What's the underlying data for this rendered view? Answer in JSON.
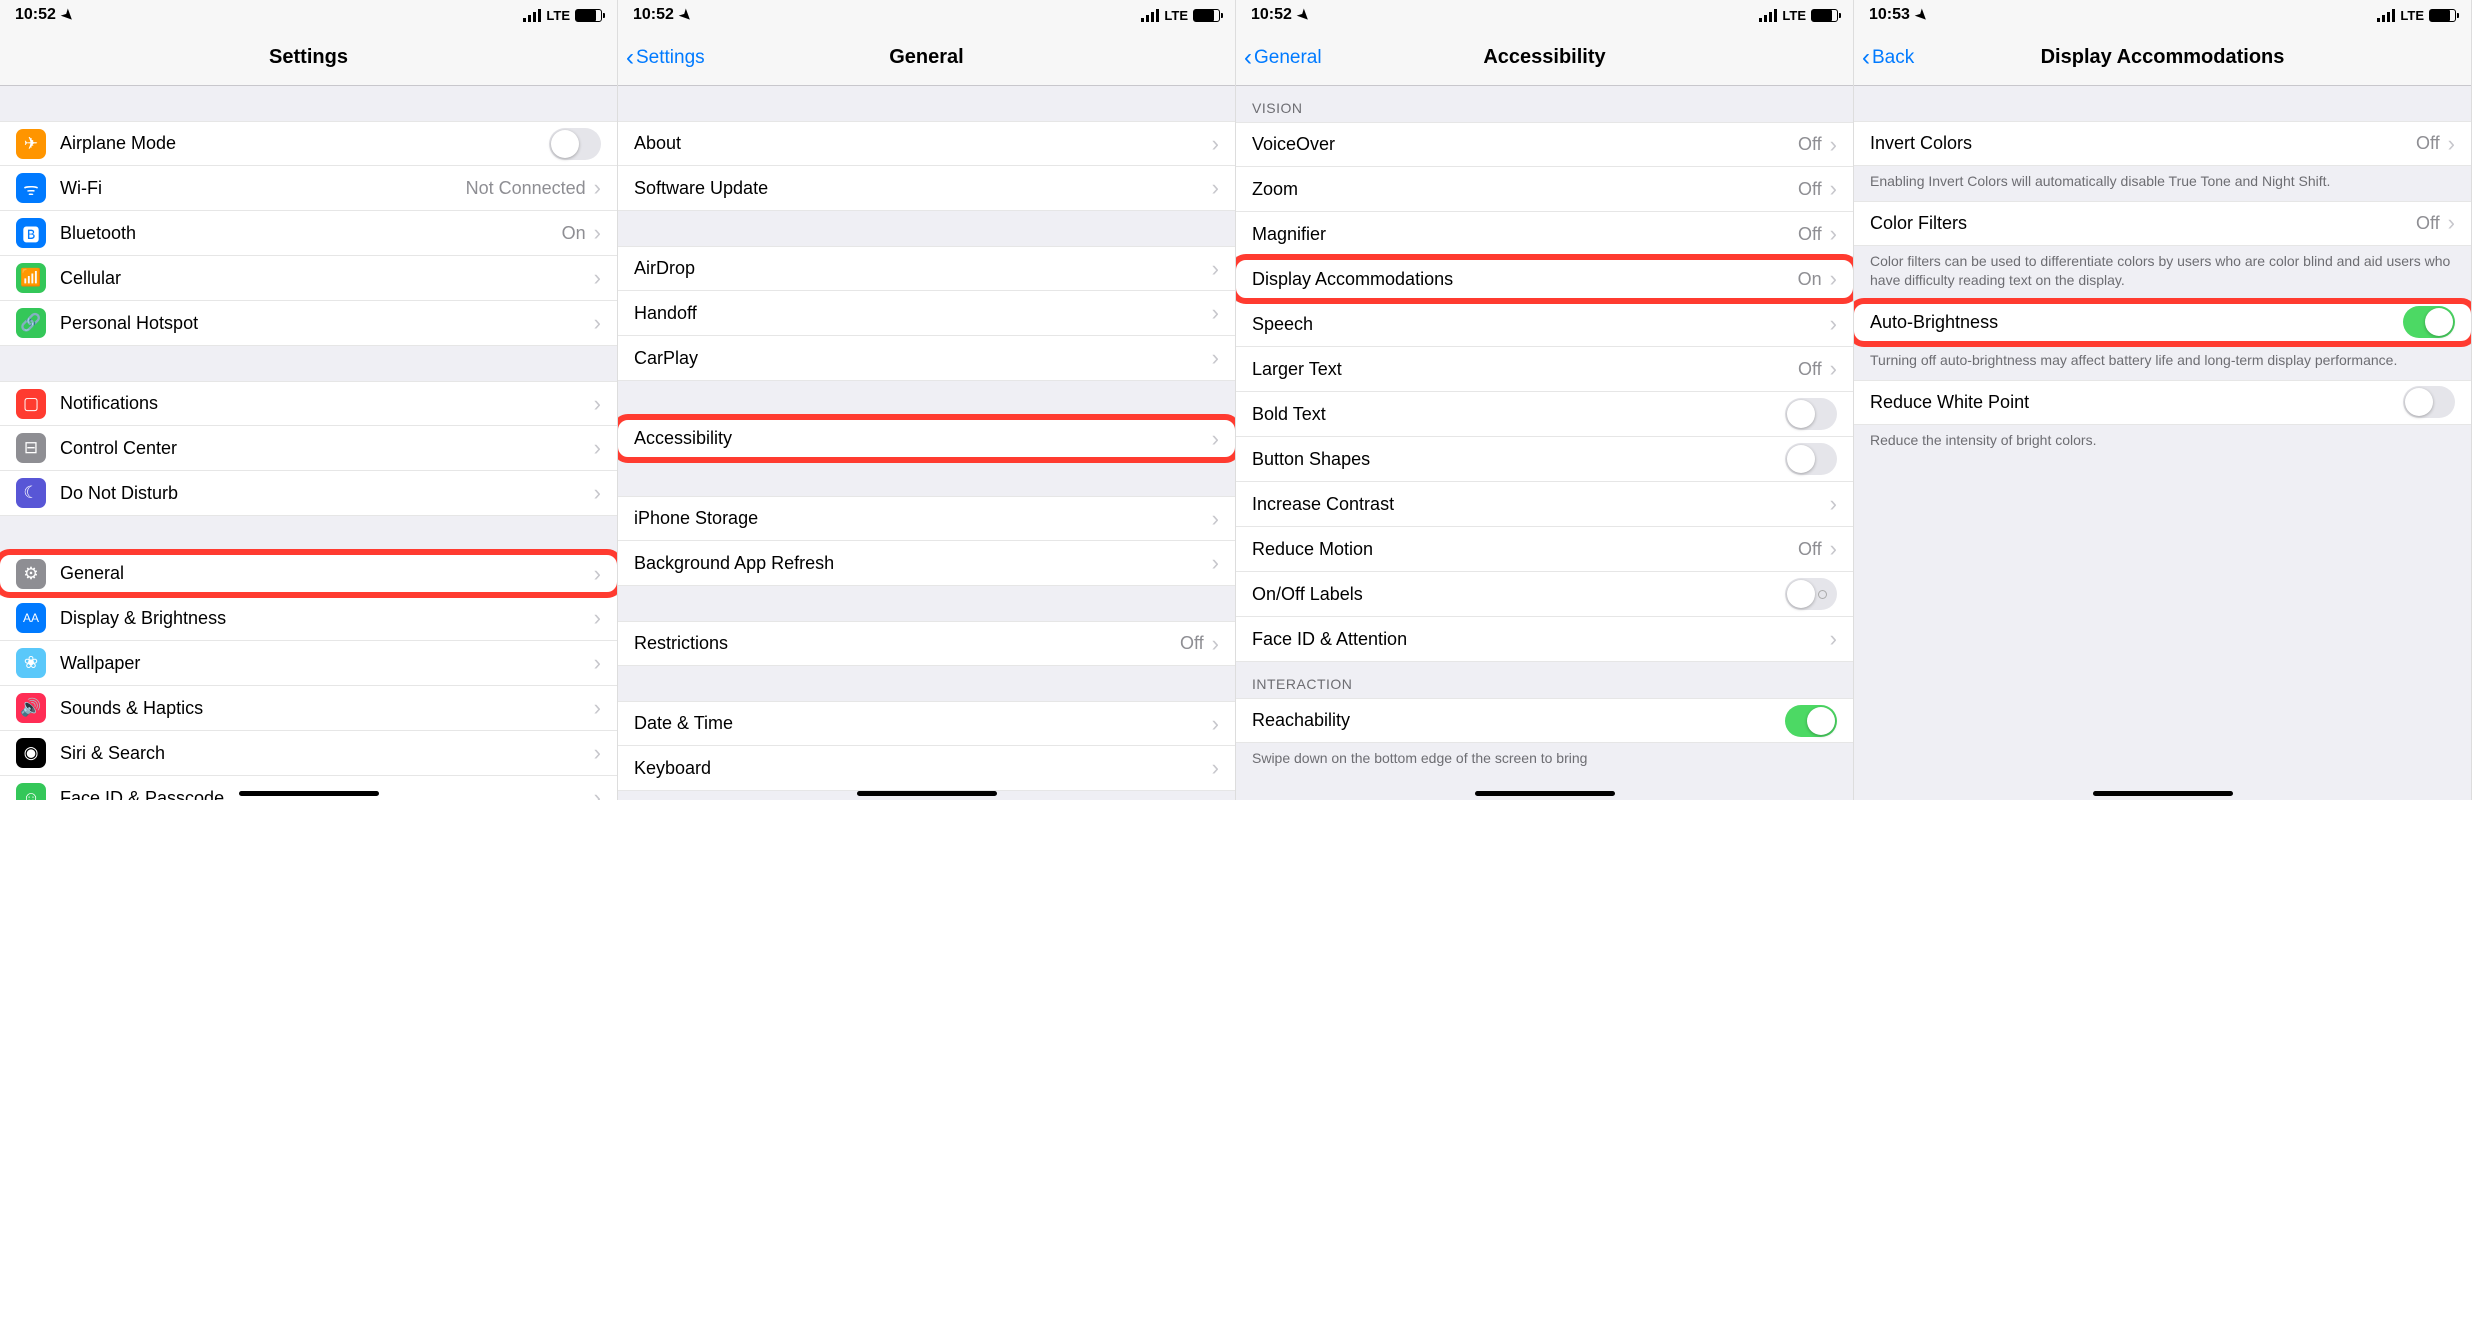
{
  "status": {
    "times": [
      "10:52",
      "10:52",
      "10:52",
      "10:53"
    ],
    "net": "LTE"
  },
  "screen1": {
    "title": "Settings",
    "g1": [
      {
        "icon": "airplane-icon",
        "cls": "ic-orange",
        "glyph": "✈",
        "label": "Airplane Mode",
        "type": "toggle",
        "on": false
      },
      {
        "icon": "wifi-icon",
        "cls": "ic-blue",
        "glyph": "ᯤ",
        "label": "Wi-Fi",
        "type": "link",
        "detail": "Not Connected"
      },
      {
        "icon": "bluetooth-icon",
        "cls": "ic-blue",
        "glyph": "🅱",
        "label": "Bluetooth",
        "type": "link",
        "detail": "On"
      },
      {
        "icon": "cellular-icon",
        "cls": "ic-green",
        "glyph": "📶",
        "label": "Cellular",
        "type": "link"
      },
      {
        "icon": "hotspot-icon",
        "cls": "ic-green",
        "glyph": "🔗",
        "label": "Personal Hotspot",
        "type": "link"
      }
    ],
    "g2": [
      {
        "icon": "notifications-icon",
        "cls": "ic-red",
        "glyph": "▢",
        "label": "Notifications",
        "type": "link"
      },
      {
        "icon": "control-center-icon",
        "cls": "ic-gray",
        "glyph": "⊟",
        "label": "Control Center",
        "type": "link"
      },
      {
        "icon": "dnd-icon",
        "cls": "ic-purple",
        "glyph": "☾",
        "label": "Do Not Disturb",
        "type": "link"
      }
    ],
    "g3": [
      {
        "icon": "general-icon",
        "cls": "ic-gray",
        "glyph": "⚙",
        "label": "General",
        "type": "link",
        "hl": true
      },
      {
        "icon": "display-icon",
        "cls": "ic-bluea",
        "glyph": "AA",
        "label": "Display & Brightness",
        "type": "link"
      },
      {
        "icon": "wallpaper-icon",
        "cls": "ic-cyan",
        "glyph": "❀",
        "label": "Wallpaper",
        "type": "link"
      },
      {
        "icon": "sounds-icon",
        "cls": "ic-pink",
        "glyph": "🔊",
        "label": "Sounds & Haptics",
        "type": "link"
      },
      {
        "icon": "siri-icon",
        "cls": "ic-black",
        "glyph": "◉",
        "label": "Siri & Search",
        "type": "link"
      },
      {
        "icon": "faceid-icon",
        "cls": "ic-green",
        "glyph": "☺",
        "label": "Face ID & Passcode",
        "type": "link"
      }
    ]
  },
  "screen2": {
    "back": "Settings",
    "title": "General",
    "g1": [
      {
        "label": "About",
        "type": "link"
      },
      {
        "label": "Software Update",
        "type": "link"
      }
    ],
    "g2": [
      {
        "label": "AirDrop",
        "type": "link"
      },
      {
        "label": "Handoff",
        "type": "link"
      },
      {
        "label": "CarPlay",
        "type": "link"
      }
    ],
    "g3": [
      {
        "label": "Accessibility",
        "type": "link",
        "hl": true
      }
    ],
    "g4": [
      {
        "label": "iPhone Storage",
        "type": "link"
      },
      {
        "label": "Background App Refresh",
        "type": "link"
      }
    ],
    "g5": [
      {
        "label": "Restrictions",
        "type": "link",
        "detail": "Off"
      }
    ],
    "g6": [
      {
        "label": "Date & Time",
        "type": "link"
      },
      {
        "label": "Keyboard",
        "type": "link"
      }
    ]
  },
  "screen3": {
    "back": "General",
    "title": "Accessibility",
    "h1": "VISION",
    "g1": [
      {
        "label": "VoiceOver",
        "type": "link",
        "detail": "Off"
      },
      {
        "label": "Zoom",
        "type": "link",
        "detail": "Off"
      },
      {
        "label": "Magnifier",
        "type": "link",
        "detail": "Off"
      },
      {
        "label": "Display Accommodations",
        "type": "link",
        "detail": "On",
        "hl": true
      },
      {
        "label": "Speech",
        "type": "link"
      },
      {
        "label": "Larger Text",
        "type": "link",
        "detail": "Off"
      },
      {
        "label": "Bold Text",
        "type": "toggle",
        "on": false
      },
      {
        "label": "Button Shapes",
        "type": "toggle",
        "on": false
      },
      {
        "label": "Increase Contrast",
        "type": "link"
      },
      {
        "label": "Reduce Motion",
        "type": "link",
        "detail": "Off"
      },
      {
        "label": "On/Off Labels",
        "type": "toggle",
        "on": false,
        "labelStyle": true
      },
      {
        "label": "Face ID & Attention",
        "type": "link"
      }
    ],
    "h2": "INTERACTION",
    "g2": [
      {
        "label": "Reachability",
        "type": "toggle",
        "on": true
      }
    ],
    "f2": "Swipe down on the bottom edge of the screen to bring"
  },
  "screen4": {
    "back": "Back",
    "title": "Display Accommodations",
    "g1": [
      {
        "label": "Invert Colors",
        "type": "link",
        "detail": "Off"
      }
    ],
    "f1": "Enabling Invert Colors will automatically disable True Tone and Night Shift.",
    "g2": [
      {
        "label": "Color Filters",
        "type": "link",
        "detail": "Off"
      }
    ],
    "f2": "Color filters can be used to differentiate colors by users who are color blind and aid users who have difficulty reading text on the display.",
    "g3": [
      {
        "label": "Auto-Brightness",
        "type": "toggle",
        "on": true,
        "hl": true
      }
    ],
    "f3": "Turning off auto-brightness may affect battery life and long-term display performance.",
    "g4": [
      {
        "label": "Reduce White Point",
        "type": "toggle",
        "on": false
      }
    ],
    "f4": "Reduce the intensity of bright colors."
  }
}
